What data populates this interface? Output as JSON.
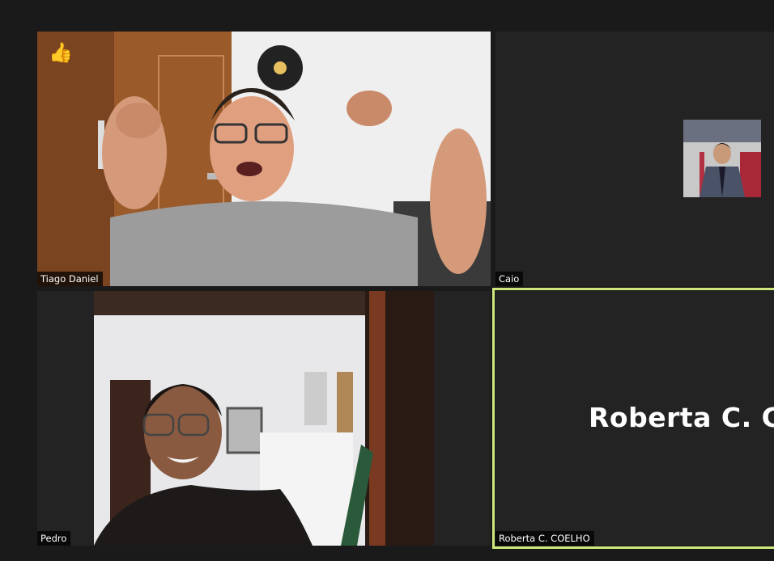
{
  "participants": [
    {
      "name": "Tiago Daniel",
      "reaction": "👍"
    },
    {
      "name": "Caio"
    },
    {
      "name": "Pedro"
    },
    {
      "name": "Roberta C. COELHO",
      "display_name": "Roberta  C.  C",
      "active_speaker": true
    }
  ],
  "colors": {
    "active_speaker_border": "#cfe87b",
    "tile_background": "#232323",
    "page_background": "#1a1a1a"
  }
}
